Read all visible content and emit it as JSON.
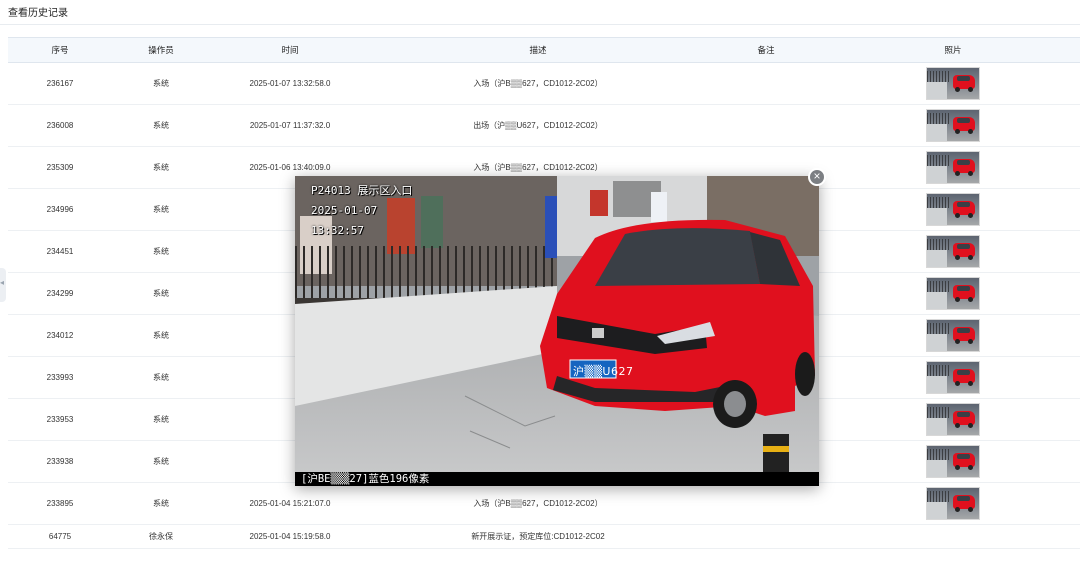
{
  "page": {
    "title": "查看历史记录"
  },
  "table": {
    "headers": {
      "seq": "序号",
      "operator": "操作员",
      "time": "时间",
      "desc": "描述",
      "remark": "备注",
      "photo": "照片"
    },
    "rows": [
      {
        "seq": "236167",
        "operator": "系统",
        "time": "2025-01-07 13:32:58.0",
        "desc": "入场（沪B▒▒627，CD1012-2C02）",
        "remark": "",
        "has_photo": true
      },
      {
        "seq": "236008",
        "operator": "系统",
        "time": "2025-01-07 11:37:32.0",
        "desc": "出场（沪▒▒U627，CD1012-2C02）",
        "remark": "",
        "has_photo": true
      },
      {
        "seq": "235309",
        "operator": "系统",
        "time": "2025-01-06 13:40:09.0",
        "desc": "入场（沪B▒▒627，CD1012-2C02）",
        "remark": "",
        "has_photo": true
      },
      {
        "seq": "234996",
        "operator": "系统",
        "time": "",
        "desc": "",
        "remark": "",
        "has_photo": true
      },
      {
        "seq": "234451",
        "operator": "系统",
        "time": "",
        "desc": "",
        "remark": "",
        "has_photo": true
      },
      {
        "seq": "234299",
        "operator": "系统",
        "time": "",
        "desc": "",
        "remark": "",
        "has_photo": true
      },
      {
        "seq": "234012",
        "operator": "系统",
        "time": "",
        "desc": "",
        "remark": "",
        "has_photo": true
      },
      {
        "seq": "233993",
        "operator": "系统",
        "time": "",
        "desc": "",
        "remark": "",
        "has_photo": true
      },
      {
        "seq": "233953",
        "operator": "系统",
        "time": "",
        "desc": "",
        "remark": "",
        "has_photo": true
      },
      {
        "seq": "233938",
        "operator": "系统",
        "time": "",
        "desc": "",
        "remark": "",
        "has_photo": true
      },
      {
        "seq": "233895",
        "operator": "系统",
        "time": "2025-01-04 15:21:07.0",
        "desc": "入场（沪B▒▒627，CD1012-2C02）",
        "remark": "",
        "has_photo": true
      },
      {
        "seq": "64775",
        "operator": "徐永保",
        "time": "2025-01-04 15:19:58.0",
        "desc": "新开展示证，预定库位:CD1012-2C02",
        "remark": "",
        "has_photo": false
      }
    ]
  },
  "modal": {
    "overlay_line1": "P24013 展示区入口",
    "overlay_date": "2025-01-07",
    "overlay_time": "13:32:57",
    "plate": "沪▒▒U627",
    "caption": "[沪BE▒▒▒27]蓝色196像素",
    "close_symbol": "×"
  },
  "colors": {
    "car": "#e0101e",
    "plate": "#1565c0",
    "header_bg": "#f4f8fc"
  },
  "icons": {
    "close": "close-icon",
    "collapse": "chevron-left-icon"
  }
}
